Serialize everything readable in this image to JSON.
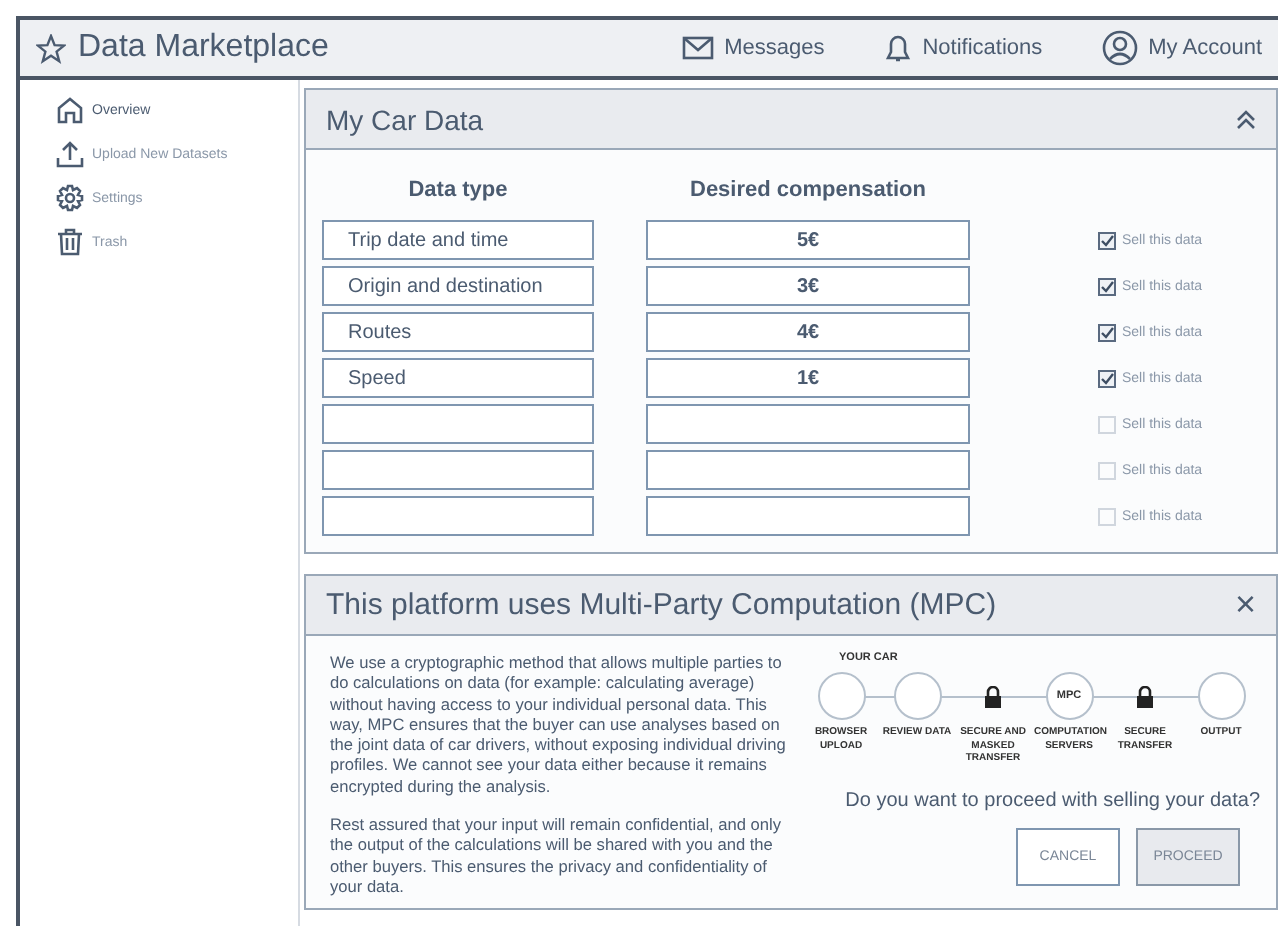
{
  "app": {
    "title": "Data Marketplace"
  },
  "nav": [
    {
      "kind": "mail",
      "label": "Messages"
    },
    {
      "kind": "bell",
      "label": "Notifications"
    },
    {
      "kind": "account",
      "label": "My Account"
    }
  ],
  "sidebar": {
    "items": [
      {
        "kind": "home",
        "label": "Overview",
        "selected": true
      },
      {
        "kind": "upload",
        "label": "Upload New Datasets",
        "selected": false
      },
      {
        "kind": "gear",
        "label": "Settings",
        "selected": false
      },
      {
        "kind": "trash",
        "label": "Trash",
        "selected": false
      }
    ]
  },
  "car_data": {
    "title": "My Car Data",
    "expanded": true,
    "columns": [
      "Data type",
      "Desired compensation"
    ],
    "rows": [
      {
        "data_type": "Trip date and time",
        "compensation": "5€",
        "sell_label": "Sell this data",
        "checked": true
      },
      {
        "data_type": "Origin and destination",
        "compensation": "3€",
        "sell_label": "Sell this data",
        "checked": true
      },
      {
        "data_type": "Routes",
        "compensation": "4€",
        "sell_label": "Sell this data",
        "checked": true
      },
      {
        "data_type": "Speed",
        "compensation": "1€",
        "sell_label": "Sell this data",
        "checked": true
      },
      {
        "sell_label": "Sell this data",
        "checked": false
      },
      {
        "sell_label": "Sell this data",
        "checked": false
      },
      {
        "sell_label": "Sell this data",
        "checked": false
      }
    ]
  },
  "mpc_dialog": {
    "title": "This platform uses Multi-Party Computation (MPC)",
    "close": "×",
    "paragraphs": [
      "We use a cryptographic method that allows multiple parties to do calculations on data (for example: calculating average) without having access to your individual personal data. This way, MPC ensures that the buyer can use analyses based on the joint data of car drivers, without exposing individual driving profiles. We cannot see your data either because it remains encrypted during the analysis.",
      "Rest assured that your input will remain confidential, and only the output of the calculations will be shared with you and the other buyers. This ensures the privacy and confidentiality of your data."
    ],
    "diagram": {
      "group_label": "YOUR CAR",
      "steps": [
        {
          "kind": "circle",
          "label": "BROWSER UPLOAD"
        },
        {
          "kind": "circle",
          "label": "REVIEW DATA"
        },
        {
          "kind": "lock",
          "label": "SECURE AND MASKED TRANSFER"
        },
        {
          "kind": "circle",
          "node_text": "MPC",
          "label": "COMPUTATION SERVERS"
        },
        {
          "kind": "lock",
          "label": "SECURE TRANSFER"
        },
        {
          "kind": "circle",
          "label": "OUTPUT"
        }
      ]
    },
    "question": "Do you want to proceed with selling your data?",
    "buttons": [
      {
        "kind": "secondary",
        "label": "CANCEL"
      },
      {
        "kind": "primary",
        "label": "PROCEED"
      }
    ]
  }
}
